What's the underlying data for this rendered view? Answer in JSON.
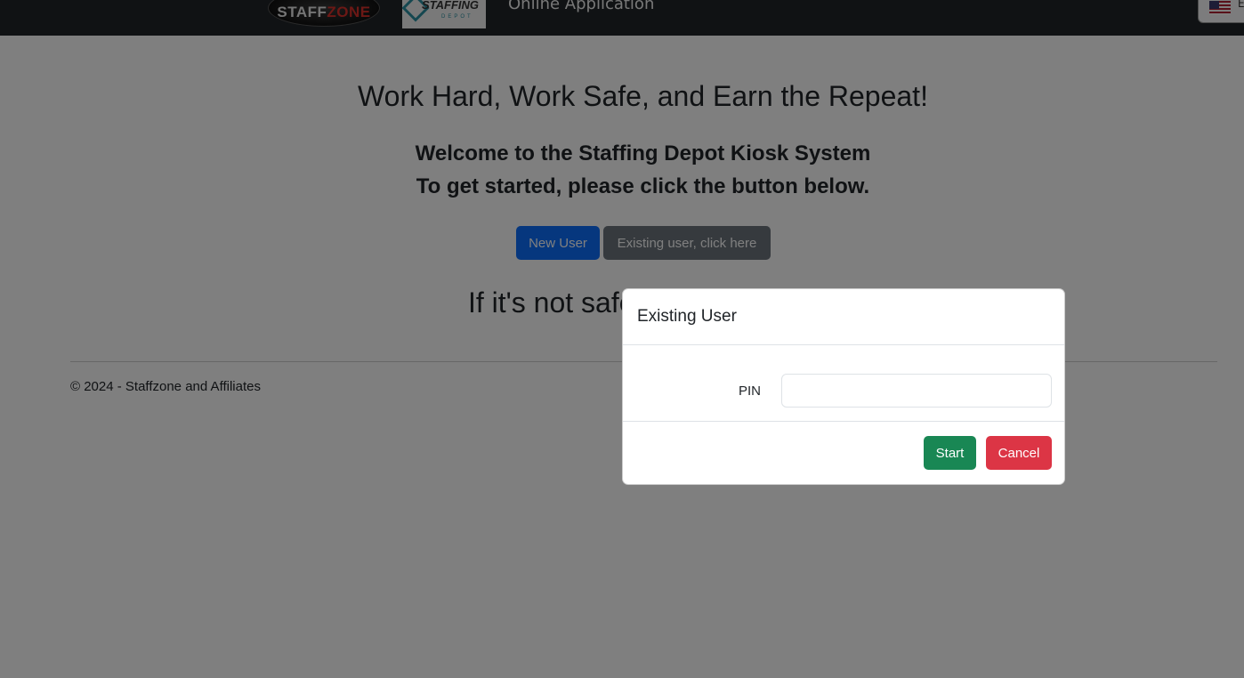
{
  "navbar": {
    "logo_staffzone": {
      "part1": "STAFF",
      "part2": "ZONE"
    },
    "logo_depot": {
      "line1": "STAFFING",
      "line2": "DEPOT"
    },
    "title": "Online Application",
    "language": {
      "icon": "us-flag-icon",
      "label": "E"
    }
  },
  "main": {
    "heading": "Work Hard, Work Safe, and Earn the Repeat!",
    "welcome_line1": "Welcome to the Staffing Depot Kiosk System",
    "welcome_line2": "To get started, please click the button below.",
    "new_user_label": "New User",
    "existing_user_label": "Existing user, click here",
    "tagline": "If it's not safe, don't do it"
  },
  "footer": {
    "copyright": "© 2024 - Staffzone and Affiliates"
  },
  "modal": {
    "title": "Existing User",
    "pin_label": "PIN",
    "pin_value": "",
    "start_label": "Start",
    "cancel_label": "Cancel"
  },
  "colors": {
    "primary": "#0d6efd",
    "secondary": "#6c757d",
    "success": "#198754",
    "danger": "#dc3545",
    "navbar": "#212529"
  }
}
